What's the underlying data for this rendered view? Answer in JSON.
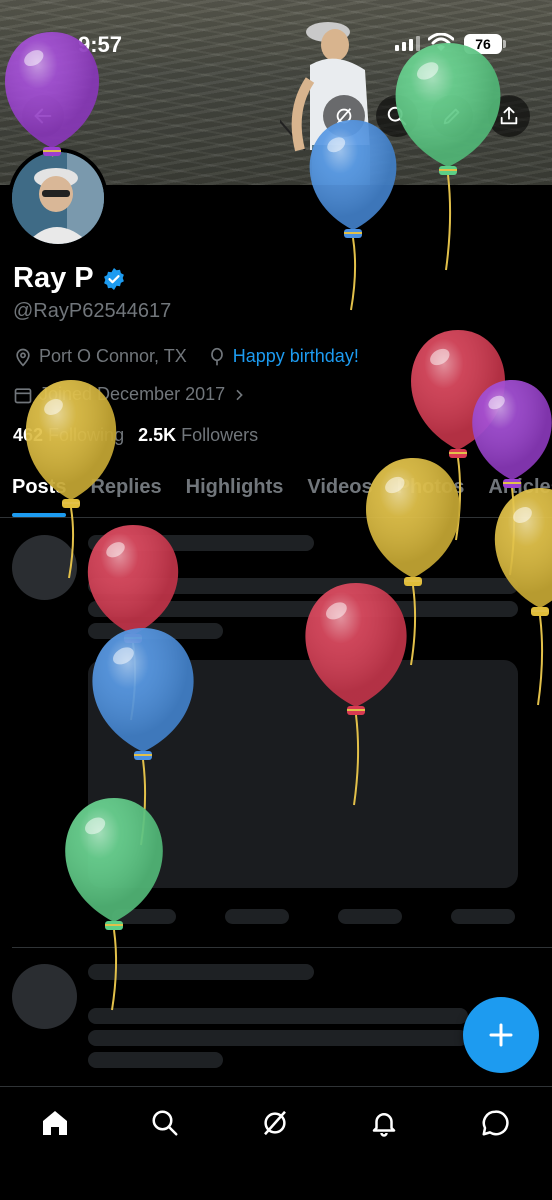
{
  "status_bar": {
    "time": "9:57",
    "battery": "76"
  },
  "profile": {
    "name": "Ray P",
    "handle": "@RayP62544617",
    "location": "Port O Connor, TX",
    "birthday": "Happy birthday!",
    "joined": "Joined December 2017",
    "following_count": "462",
    "following_label": "Following",
    "followers_count": "2.5K",
    "followers_label": "Followers"
  },
  "tabs": [
    "Posts",
    "Replies",
    "Highlights",
    "Videos",
    "Photos",
    "Articles"
  ],
  "active_tab": "Posts",
  "icons": {
    "header": [
      "back-icon",
      "grok-icon",
      "search-icon",
      "edit-icon",
      "share-icon"
    ],
    "bottom_nav": [
      "home-icon",
      "search-icon",
      "grok-icon",
      "notifications-icon",
      "messages-icon"
    ],
    "fab": "plus-icon"
  },
  "colors": {
    "accent": "#1d9bf0",
    "balloon_purple": "#9b3fd1",
    "balloon_green": "#5ccf86",
    "balloon_blue": "#4a90e2",
    "balloon_red": "#d93a52",
    "balloon_yellow": "#e0bd3a"
  }
}
